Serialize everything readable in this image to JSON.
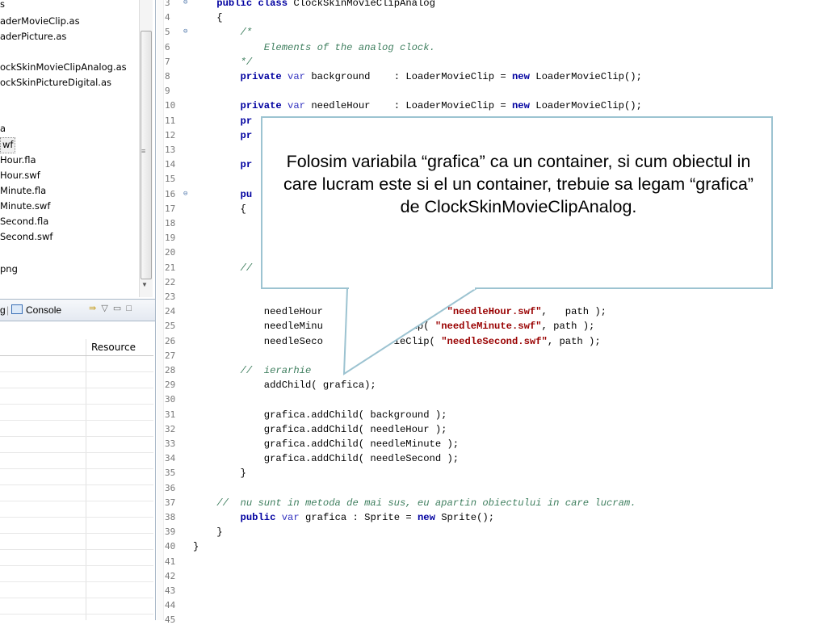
{
  "file_tree": {
    "items": [
      {
        "label": "s"
      },
      {
        "label": "aderMovieClip.as"
      },
      {
        "label": "aderPicture.as"
      },
      {
        "label": ""
      },
      {
        "label": "ockSkinMovieClipAnalog.as"
      },
      {
        "label": "ockSkinPictureDigital.as"
      },
      {
        "label": ""
      },
      {
        "label": ""
      },
      {
        "label": "a"
      },
      {
        "label": "wf"
      },
      {
        "label": "Hour.fla"
      },
      {
        "label": "Hour.swf"
      },
      {
        "label": "Minute.fla"
      },
      {
        "label": "Minute.swf"
      },
      {
        "label": "Second.fla"
      },
      {
        "label": "Second.swf"
      },
      {
        "label": ""
      },
      {
        "label": "png"
      }
    ],
    "selected_index": 9
  },
  "view_tabs": {
    "left_fragment": "g",
    "console_label": "Console"
  },
  "problems_table": {
    "columns": [
      "",
      "Resource"
    ]
  },
  "editor": {
    "lines": [
      {
        "n": "3",
        "fold": true,
        "parts": [
          {
            "t": "    ",
            "c": ""
          },
          {
            "t": "public",
            "c": "kw"
          },
          {
            "t": " ",
            "c": ""
          },
          {
            "t": "class",
            "c": "kw"
          },
          {
            "t": " ClockSkinMovieClipAnalog",
            "c": ""
          }
        ]
      },
      {
        "n": "4",
        "parts": [
          {
            "t": "    {",
            "c": ""
          }
        ]
      },
      {
        "n": "5",
        "fold": true,
        "parts": [
          {
            "t": "        /*",
            "c": "cm"
          }
        ]
      },
      {
        "n": "6",
        "parts": [
          {
            "t": "            Elements of the analog clock.",
            "c": "cm"
          }
        ]
      },
      {
        "n": "7",
        "parts": [
          {
            "t": "        */",
            "c": "cm"
          }
        ]
      },
      {
        "n": "8",
        "parts": [
          {
            "t": "        ",
            "c": ""
          },
          {
            "t": "private",
            "c": "kw"
          },
          {
            "t": " ",
            "c": ""
          },
          {
            "t": "var",
            "c": "kw2"
          },
          {
            "t": " background    : LoaderMovieClip = ",
            "c": ""
          },
          {
            "t": "new",
            "c": "kw"
          },
          {
            "t": " LoaderMovieClip();",
            "c": ""
          }
        ]
      },
      {
        "n": "9",
        "parts": []
      },
      {
        "n": "10",
        "parts": [
          {
            "t": "        ",
            "c": ""
          },
          {
            "t": "private",
            "c": "kw"
          },
          {
            "t": " ",
            "c": ""
          },
          {
            "t": "var",
            "c": "kw2"
          },
          {
            "t": " needleHour    : LoaderMovieClip = ",
            "c": ""
          },
          {
            "t": "new",
            "c": "kw"
          },
          {
            "t": " LoaderMovieClip();",
            "c": ""
          }
        ]
      },
      {
        "n": "11",
        "parts": [
          {
            "t": "        ",
            "c": ""
          },
          {
            "t": "pr",
            "c": "kw"
          }
        ]
      },
      {
        "n": "12",
        "parts": [
          {
            "t": "        ",
            "c": ""
          },
          {
            "t": "pr",
            "c": "kw"
          }
        ]
      },
      {
        "n": "13",
        "parts": []
      },
      {
        "n": "14",
        "parts": [
          {
            "t": "        ",
            "c": ""
          },
          {
            "t": "pr",
            "c": "kw"
          }
        ]
      },
      {
        "n": "15",
        "parts": []
      },
      {
        "n": "16",
        "fold": true,
        "parts": [
          {
            "t": "        ",
            "c": ""
          },
          {
            "t": "pu",
            "c": "kw"
          }
        ]
      },
      {
        "n": "17",
        "parts": [
          {
            "t": "        {",
            "c": ""
          }
        ]
      },
      {
        "n": "18",
        "parts": []
      },
      {
        "n": "19",
        "parts": []
      },
      {
        "n": "20",
        "parts": []
      },
      {
        "n": "21",
        "parts": [
          {
            "t": "        //",
            "c": "cm"
          }
        ]
      },
      {
        "n": "22",
        "parts": []
      },
      {
        "n": "23",
        "parts": []
      },
      {
        "n": "24",
        "parts": [
          {
            "t": "            needleHour ",
            "c": ""
          },
          {
            "t": "               (    ",
            "c": ""
          },
          {
            "t": "\"needleHour.swf\"",
            "c": "str"
          },
          {
            "t": ",   path );",
            "c": ""
          }
        ]
      },
      {
        "n": "25",
        "parts": [
          {
            "t": "            needleMinu",
            "c": ""
          },
          {
            "t": "           ieClip( ",
            "c": ""
          },
          {
            "t": "\"needleMinute.swf\"",
            "c": "str"
          },
          {
            "t": ", path );",
            "c": ""
          }
        ]
      },
      {
        "n": "26",
        "parts": [
          {
            "t": "            needleSeco",
            "c": ""
          },
          {
            "t": "          ovieClip( ",
            "c": ""
          },
          {
            "t": "\"needleSecond.swf\"",
            "c": "str"
          },
          {
            "t": ", path );",
            "c": ""
          }
        ]
      },
      {
        "n": "27",
        "parts": []
      },
      {
        "n": "28",
        "parts": [
          {
            "t": "        //  ierarhie",
            "c": "cm"
          }
        ]
      },
      {
        "n": "29",
        "parts": [
          {
            "t": "            addChild( grafica);",
            "c": ""
          }
        ]
      },
      {
        "n": "30",
        "parts": []
      },
      {
        "n": "31",
        "parts": [
          {
            "t": "            grafica.addChild( background );",
            "c": ""
          }
        ]
      },
      {
        "n": "32",
        "parts": [
          {
            "t": "            grafica.addChild( needleHour );",
            "c": ""
          }
        ]
      },
      {
        "n": "33",
        "parts": [
          {
            "t": "            grafica.addChild( needleMinute );",
            "c": ""
          }
        ]
      },
      {
        "n": "34",
        "parts": [
          {
            "t": "            grafica.addChild( needleSecond );",
            "c": ""
          }
        ]
      },
      {
        "n": "35",
        "parts": [
          {
            "t": "        }",
            "c": ""
          }
        ]
      },
      {
        "n": "36",
        "parts": []
      },
      {
        "n": "37",
        "parts": [
          {
            "t": "    //  nu sunt in metoda de mai sus, eu apartin obiectului in care lucram.",
            "c": "cm"
          }
        ]
      },
      {
        "n": "38",
        "parts": [
          {
            "t": "        ",
            "c": ""
          },
          {
            "t": "public",
            "c": "kw"
          },
          {
            "t": " ",
            "c": ""
          },
          {
            "t": "var",
            "c": "kw2"
          },
          {
            "t": " grafica : Sprite = ",
            "c": ""
          },
          {
            "t": "new",
            "c": "kw"
          },
          {
            "t": " Sprite();",
            "c": ""
          }
        ]
      },
      {
        "n": "39",
        "parts": [
          {
            "t": "    }",
            "c": ""
          }
        ]
      },
      {
        "n": "40",
        "parts": [
          {
            "t": "}",
            "c": ""
          }
        ]
      },
      {
        "n": "41",
        "parts": []
      },
      {
        "n": "42",
        "parts": []
      },
      {
        "n": "43",
        "parts": []
      },
      {
        "n": "44",
        "parts": []
      },
      {
        "n": "45",
        "parts": []
      }
    ]
  },
  "callout": {
    "text": "Folosim variabila “grafica” ca un container, si cum obiectul in care lucram este si el un container, trebuie sa legam “grafica” de ClockSkinMovieClipAnalog."
  },
  "colors": {
    "keyword": "#0000a0",
    "comment": "#3f7f5f",
    "string": "#990000",
    "callout_border": "#9cc3d1"
  }
}
